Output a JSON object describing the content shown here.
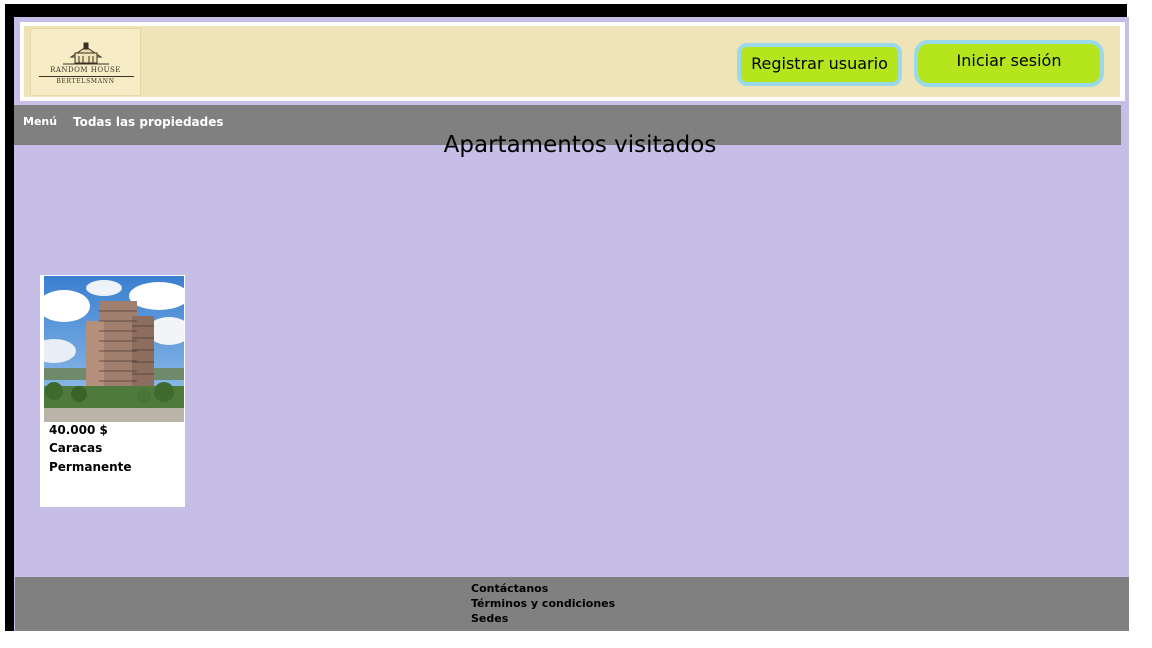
{
  "header": {
    "logo": {
      "line1": "RANDOM HOUSE",
      "line2": "BERTELSMANN"
    },
    "register_label": "Registrar usuario",
    "login_label": "Iniciar sesión"
  },
  "nav": {
    "menu_label": "Menú",
    "all_properties_label": "Todas las propiedades"
  },
  "main": {
    "title": "Apartamentos visitados",
    "cards": [
      {
        "price": "40.000 $",
        "city": "Caracas",
        "type": "Permanente"
      }
    ]
  },
  "footer": {
    "links": [
      "Contáctanos",
      "Términos y condiciones",
      "Sedes"
    ]
  },
  "colors": {
    "page_bg": "#c6bee6",
    "header_bg": "#efe4b8",
    "nav_bg": "#808080",
    "button_bg": "#b5e61d",
    "button_border": "#99d9ea"
  }
}
